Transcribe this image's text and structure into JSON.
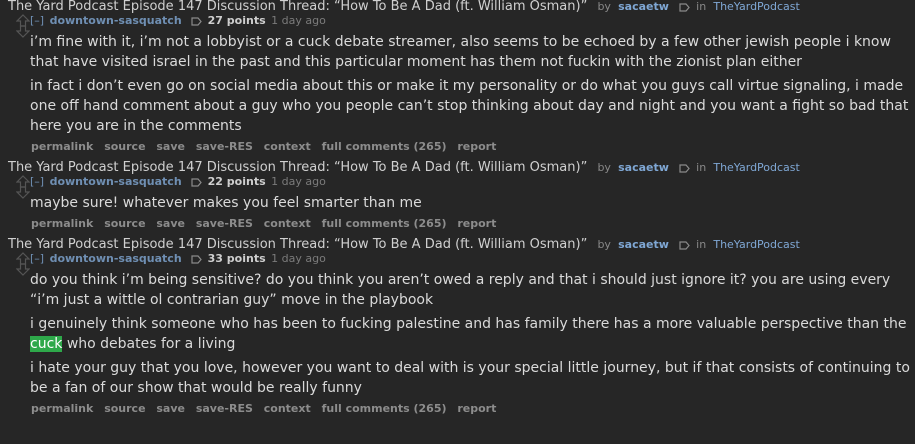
{
  "comments": [
    {
      "thread_title": "The Yard Podcast Episode 147 Discussion Thread: “How To Be A Dad (ft. William Osman)”",
      "by": "by",
      "thread_user": "sacaetw",
      "in": "in",
      "subreddit": "TheYardPodcast",
      "collapse": "[–]",
      "author": "downtown-sasquatch",
      "points": "27 points",
      "age": "1 day ago",
      "paragraphs": [
        "i’m fine with it, i’m not a lobbyist or a cuck debate streamer, also seems to be echoed by a few other jewish people i know that have visited israel in the past and this particular moment has them not fuckin with the zionist plan either",
        "in fact i don’t even go on social media about this or make it my personality or do what you guys call virtue signaling, i made one off hand comment about a guy who you people can’t stop thinking about day and night and you want a fight so bad that here you are in the comments"
      ]
    },
    {
      "thread_title": "The Yard Podcast Episode 147 Discussion Thread: “How To Be A Dad (ft. William Osman)”",
      "by": "by",
      "thread_user": "sacaetw",
      "in": "in",
      "subreddit": "TheYardPodcast",
      "collapse": "[–]",
      "author": "downtown-sasquatch",
      "points": "22 points",
      "age": "1 day ago",
      "paragraphs": [
        "maybe sure! whatever makes you feel smarter than me"
      ]
    },
    {
      "thread_title": "The Yard Podcast Episode 147 Discussion Thread: “How To Be A Dad (ft. William Osman)”",
      "by": "by",
      "thread_user": "sacaetw",
      "in": "in",
      "subreddit": "TheYardPodcast",
      "collapse": "[–]",
      "author": "downtown-sasquatch",
      "points": "33 points",
      "age": "1 day ago",
      "paragraphs": [
        "do you think i’m being sensitive? do you think you aren’t owed a reply and that i should just ignore it? you are using every “i’m just a wittle ol contrarian guy” move in the playbook",
        "i genuinely think someone who has been to fucking palestine and has family there has a more valuable perspective than the",
        "i hate your guy that you love, however you want to deal with is your special little journey, but if that consists of continuing to be a fan of our show that would be really funny"
      ],
      "highlight_word": "cuck",
      "after_highlight": "who debates for a living"
    }
  ],
  "buttons": {
    "permalink": "permalink",
    "source": "source",
    "save": "save",
    "save_res": "save-RES",
    "context": "context",
    "full_comments": "full comments (265)",
    "report": "report"
  }
}
